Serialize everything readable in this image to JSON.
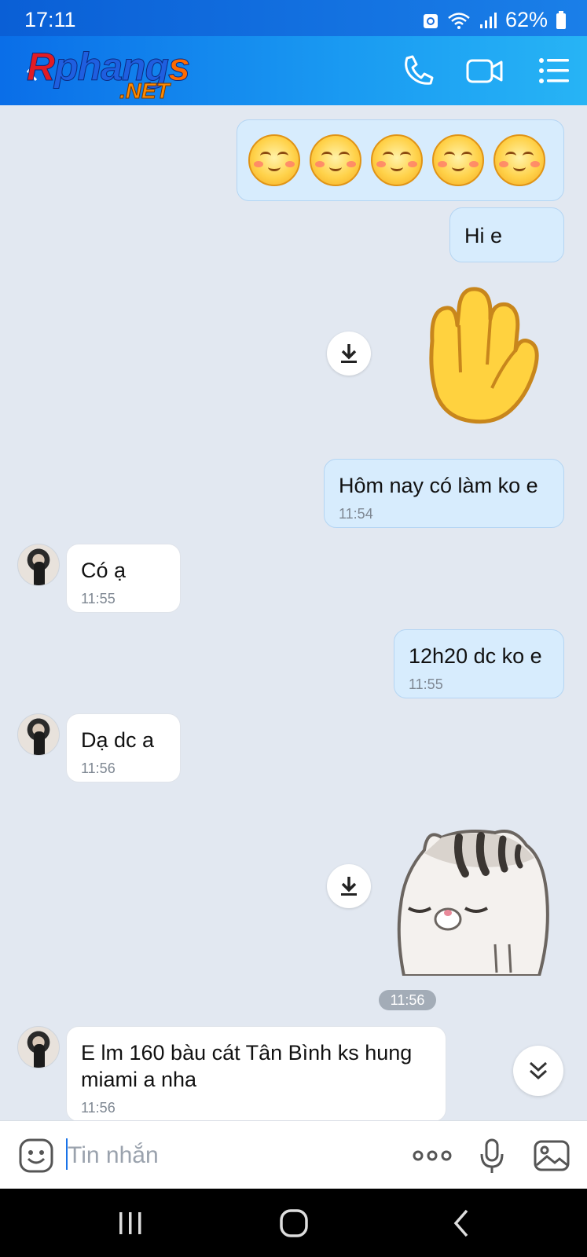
{
  "status_bar": {
    "time": "17:11",
    "battery": "62%"
  },
  "header": {
    "logo_part1": "R",
    "logo_part2": "phang",
    "logo_part3": "s",
    "logo_domain": ".NET"
  },
  "messages": [
    {
      "side": "sent",
      "type": "emoji_row",
      "emoji": "blushing-smile-emoji",
      "count": 5
    },
    {
      "side": "sent",
      "type": "text",
      "text": "Hi e"
    },
    {
      "side": "sent",
      "type": "sticker",
      "sticker": "raised-hand-sticker"
    },
    {
      "side": "sent",
      "type": "text",
      "text": "Hôm nay có làm ko e",
      "time": "11:54"
    },
    {
      "side": "received",
      "type": "text",
      "text": "Có ạ",
      "time": "11:55"
    },
    {
      "side": "sent",
      "type": "text",
      "text": "12h20 dc ko e",
      "time": "11:55"
    },
    {
      "side": "received",
      "type": "text",
      "text": "Dạ dc a",
      "time": "11:56"
    },
    {
      "side": "sent",
      "type": "sticker",
      "sticker": "tabby-cat-sticker",
      "time": "11:56"
    },
    {
      "side": "received",
      "type": "text",
      "text": "E lm 160 bàu cát Tân Bình ks hung miami a nha",
      "time": "11:56"
    }
  ],
  "composer": {
    "placeholder": "Tin nhắn"
  },
  "colors": {
    "header_start": "#0a6ee8",
    "header_end": "#27b4f5",
    "chat_background": "#e2e8f1",
    "sent_bubble": "#d7ecfd",
    "received_bubble": "#ffffff"
  }
}
